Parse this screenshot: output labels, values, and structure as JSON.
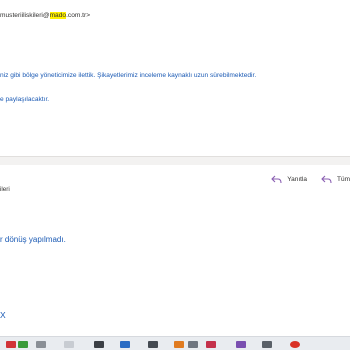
{
  "message_top": {
    "sender_prefix": "musteriiliskileri@",
    "sender_highlight": "mado",
    "sender_suffix": ".com.tr>",
    "body_line_1": "niz gibi bölge yöneticimize ilettik. Şikayetlerimiz inceleme kaynaklı uzun sürebilmektedir.",
    "body_line_2": "e paylaşılacaktır."
  },
  "message_bottom": {
    "reply_label": "Yanıtla",
    "reply_all_label": "Tüm",
    "to_line": "ileri",
    "body_line": "r dönüş yapılmadı.",
    "trailing_mark": "X"
  },
  "colors": {
    "link_blue": "#1b5ab4",
    "highlight": "#fff100",
    "reply_arrow": "#8a5fb2"
  },
  "taskbar": {
    "icons": [
      "red-app-icon",
      "green-app-icon",
      "generic-app-icon",
      "document-icon",
      "dark-app-icon",
      "blue-app-icon",
      "dark-app-icon",
      "orange-app-icon",
      "generic-app-icon",
      "red-app-icon",
      "purple-app-icon",
      "generic-app-icon",
      "browser-icon"
    ]
  }
}
